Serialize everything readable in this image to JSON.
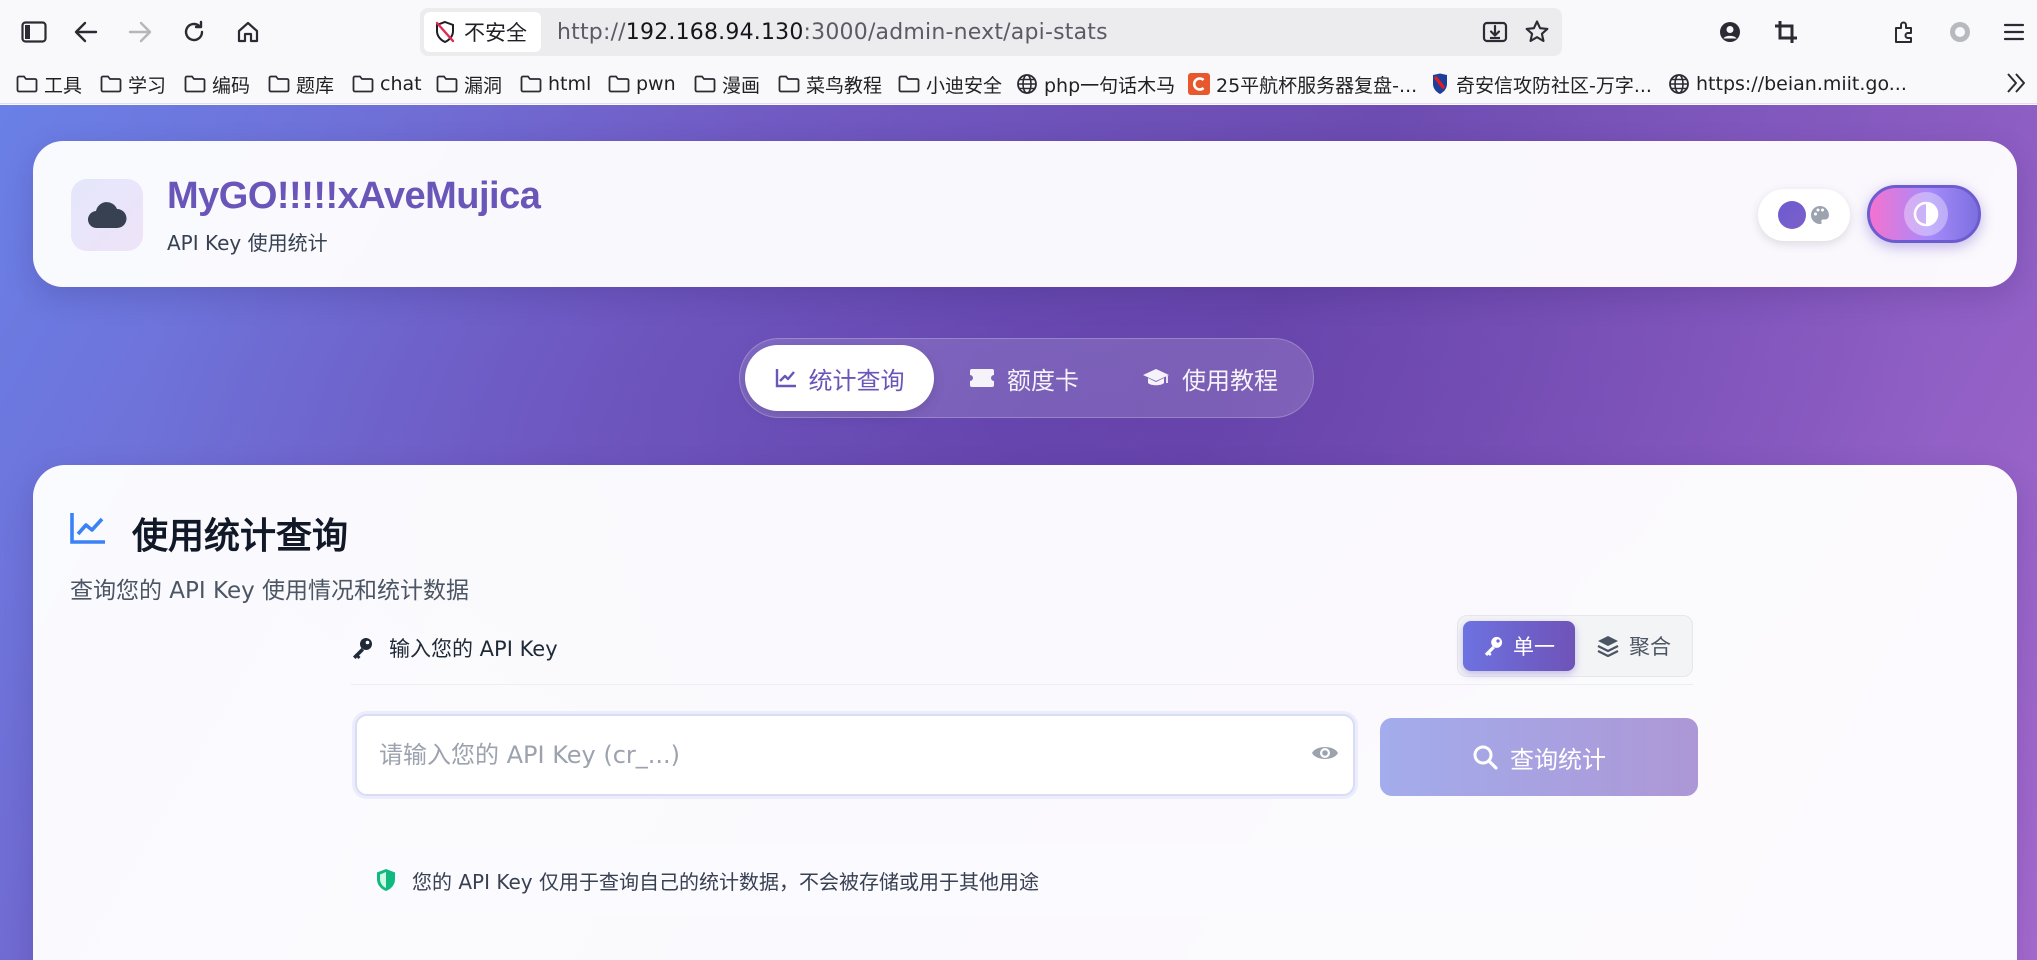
{
  "browser": {
    "security_label": "不安全",
    "url_prefix": "http://",
    "url_host": "192.168.94.130",
    "url_path": ":3000/admin-next/api-stats",
    "bookmarks": [
      {
        "label": "工具",
        "icon": "folder-icon"
      },
      {
        "label": "学习",
        "icon": "folder-icon"
      },
      {
        "label": "编码",
        "icon": "folder-icon"
      },
      {
        "label": "题库",
        "icon": "folder-icon"
      },
      {
        "label": "chat",
        "icon": "folder-icon"
      },
      {
        "label": "漏洞",
        "icon": "folder-icon"
      },
      {
        "label": "html",
        "icon": "folder-icon"
      },
      {
        "label": "pwn",
        "icon": "folder-icon"
      },
      {
        "label": "漫画",
        "icon": "folder-icon"
      },
      {
        "label": "菜鸟教程",
        "icon": "folder-icon"
      },
      {
        "label": "小迪安全",
        "icon": "folder-icon"
      },
      {
        "label": "php一句话木马",
        "icon": "globe-icon"
      },
      {
        "label": "25平航杯服务器复盘-...",
        "icon": "c-logo-icon"
      },
      {
        "label": "奇安信攻防社区-万字...",
        "icon": "qianxin-logo-icon"
      },
      {
        "label": "https://beian.miit.go...",
        "icon": "globe-icon"
      }
    ]
  },
  "header": {
    "brand": "MyGO!!!!!xAveMujica",
    "subtitle": "API Key 使用统计",
    "logo_icon": "cloud-icon"
  },
  "tabs": [
    {
      "label": "统计查询",
      "icon": "chart-line-icon",
      "active": true
    },
    {
      "label": "额度卡",
      "icon": "ticket-icon",
      "active": false
    },
    {
      "label": "使用教程",
      "icon": "graduation-cap-icon",
      "active": false
    }
  ],
  "main": {
    "title": "使用统计查询",
    "description": "查询您的 API Key 使用情况和统计数据",
    "key_label": "输入您的 API Key",
    "mode_single": "单一",
    "mode_aggregate": "聚合",
    "input_placeholder": "请输入您的 API Key (cr_...)",
    "input_value": "",
    "query_button": "查询统计",
    "notice": "您的 API Key 仅用于查询自己的统计数据，不会被存储或用于其他用途"
  },
  "colors": {
    "accent": "#6a55b8",
    "gradient_start": "#6a80e6",
    "gradient_end": "#a56bcf",
    "notice_shield": "#10b981"
  }
}
